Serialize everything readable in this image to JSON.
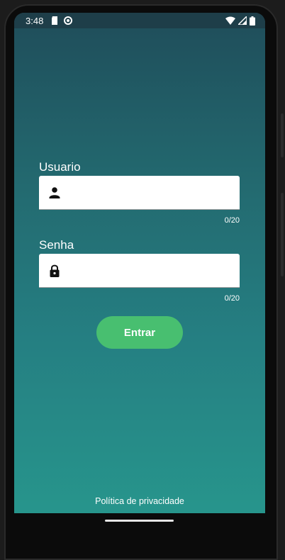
{
  "status_bar": {
    "time": "3:48",
    "icons_left": [
      "sd-card-icon",
      "sync-icon"
    ],
    "icons_right": [
      "wifi-icon",
      "signal-icon",
      "battery-icon"
    ]
  },
  "login_form": {
    "username": {
      "label": "Usuario",
      "value": "",
      "counter": "0/20",
      "icon": "person-icon"
    },
    "password": {
      "label": "Senha",
      "value": "",
      "counter": "0/20",
      "icon": "lock-icon"
    },
    "submit_label": "Entrar"
  },
  "footer": {
    "privacy_label": "Política de privacidade"
  },
  "colors": {
    "gradient_top": "#1f4d5a",
    "gradient_bottom": "#27958c",
    "button": "#48bf70",
    "field_background": "#ffffff"
  }
}
